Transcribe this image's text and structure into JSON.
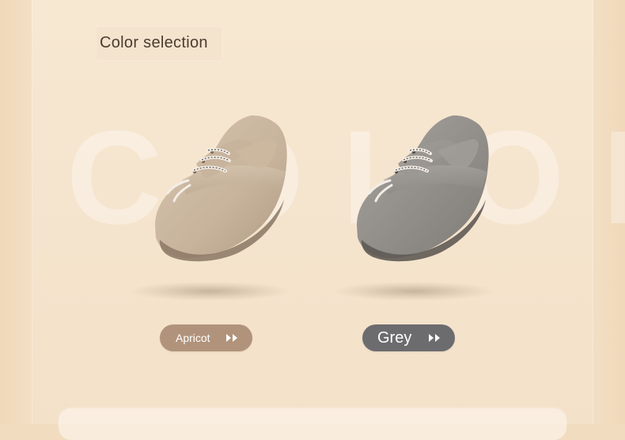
{
  "section": {
    "title": "Color selection",
    "background_word": "COLOR"
  },
  "products": [
    {
      "name": "Apricot",
      "color": "#b9a58d",
      "button_color": "#b1937b",
      "icon": "double-arrow-right-icon"
    },
    {
      "name": "Grey",
      "color": "#8b8885",
      "button_color": "#6c6c6f",
      "icon": "double-arrow-right-icon"
    }
  ],
  "theme": {
    "page_background": "#f1dcc0",
    "panel_background": "#f6e6cf",
    "text_dark": "#4a3b2f"
  }
}
